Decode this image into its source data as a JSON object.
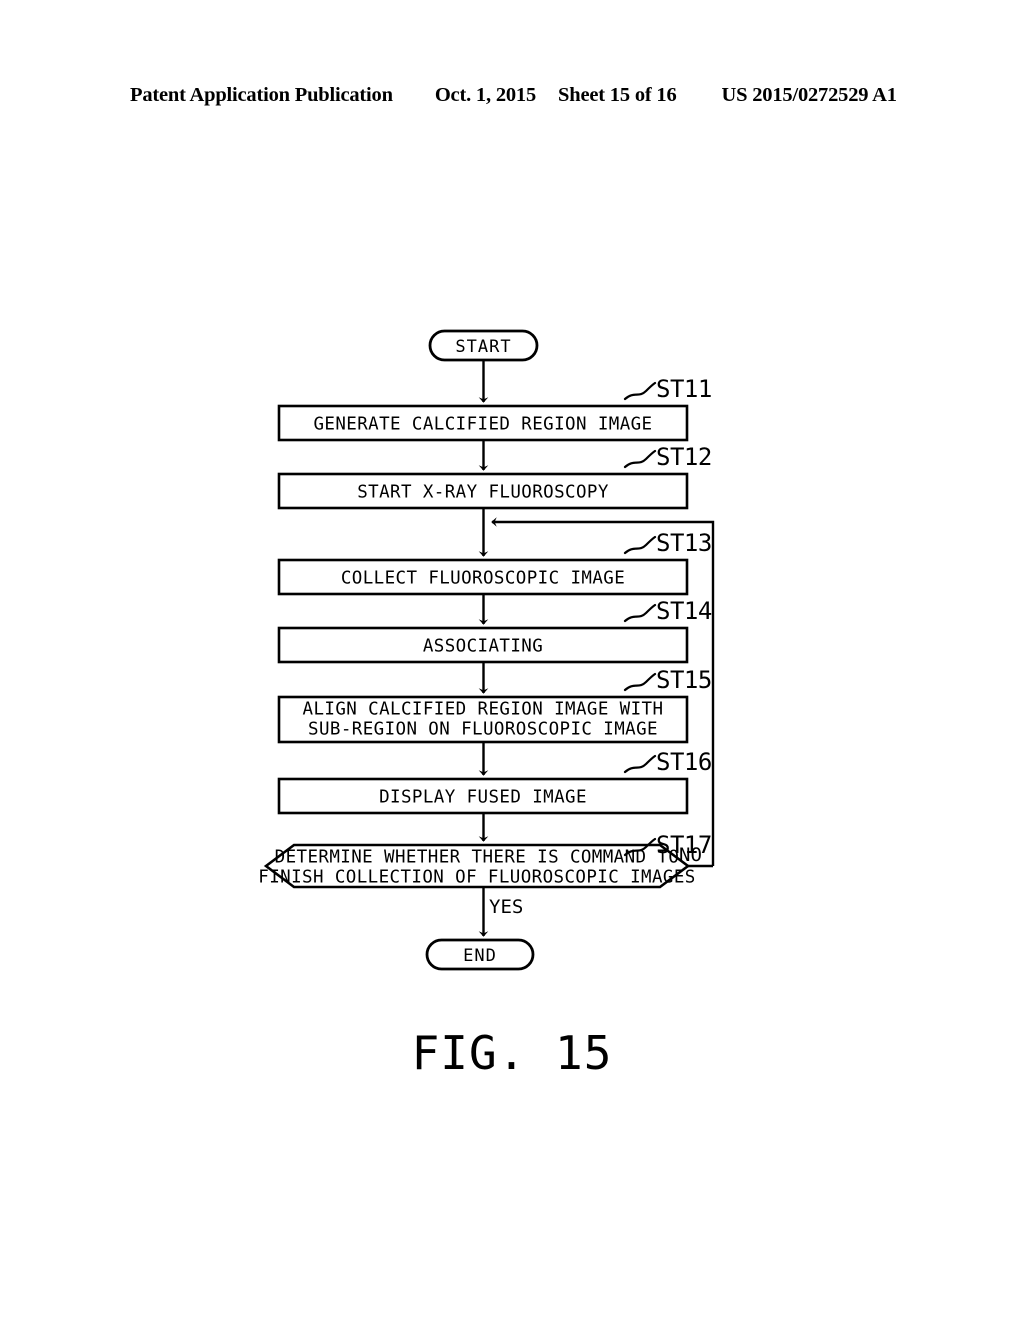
{
  "header": {
    "publication": "Patent Application Publication",
    "date": "Oct. 1, 2015",
    "sheet": "Sheet 15 of 16",
    "patent_number": "US 2015/0272529 A1"
  },
  "figure": {
    "caption": "FIG. 15",
    "type": "flowchart"
  },
  "flowchart": {
    "start_label": "START",
    "end_label": "END",
    "steps": [
      {
        "ref": "ST11",
        "text_line1": "GENERATE CALCIFIED REGION IMAGE",
        "text_line2": ""
      },
      {
        "ref": "ST12",
        "text_line1": "START X-RAY FLUOROSCOPY",
        "text_line2": ""
      },
      {
        "ref": "ST13",
        "text_line1": "COLLECT FLUOROSCOPIC IMAGE",
        "text_line2": ""
      },
      {
        "ref": "ST14",
        "text_line1": "ASSOCIATING",
        "text_line2": ""
      },
      {
        "ref": "ST15",
        "text_line1": "ALIGN CALCIFIED REGION IMAGE WITH",
        "text_line2": "SUB-REGION ON FLUOROSCOPIC IMAGE"
      },
      {
        "ref": "ST16",
        "text_line1": "DISPLAY FUSED IMAGE",
        "text_line2": ""
      }
    ],
    "decision": {
      "ref": "ST17",
      "text_line1": "DETERMINE WHETHER THERE IS COMMAND TO",
      "text_line2": "FINISH COLLECTION OF FLUOROSCOPIC IMAGES",
      "branch_no": "NO",
      "branch_yes": "YES"
    },
    "colors": {
      "ink": "#000000",
      "paper": "#ffffff"
    }
  }
}
